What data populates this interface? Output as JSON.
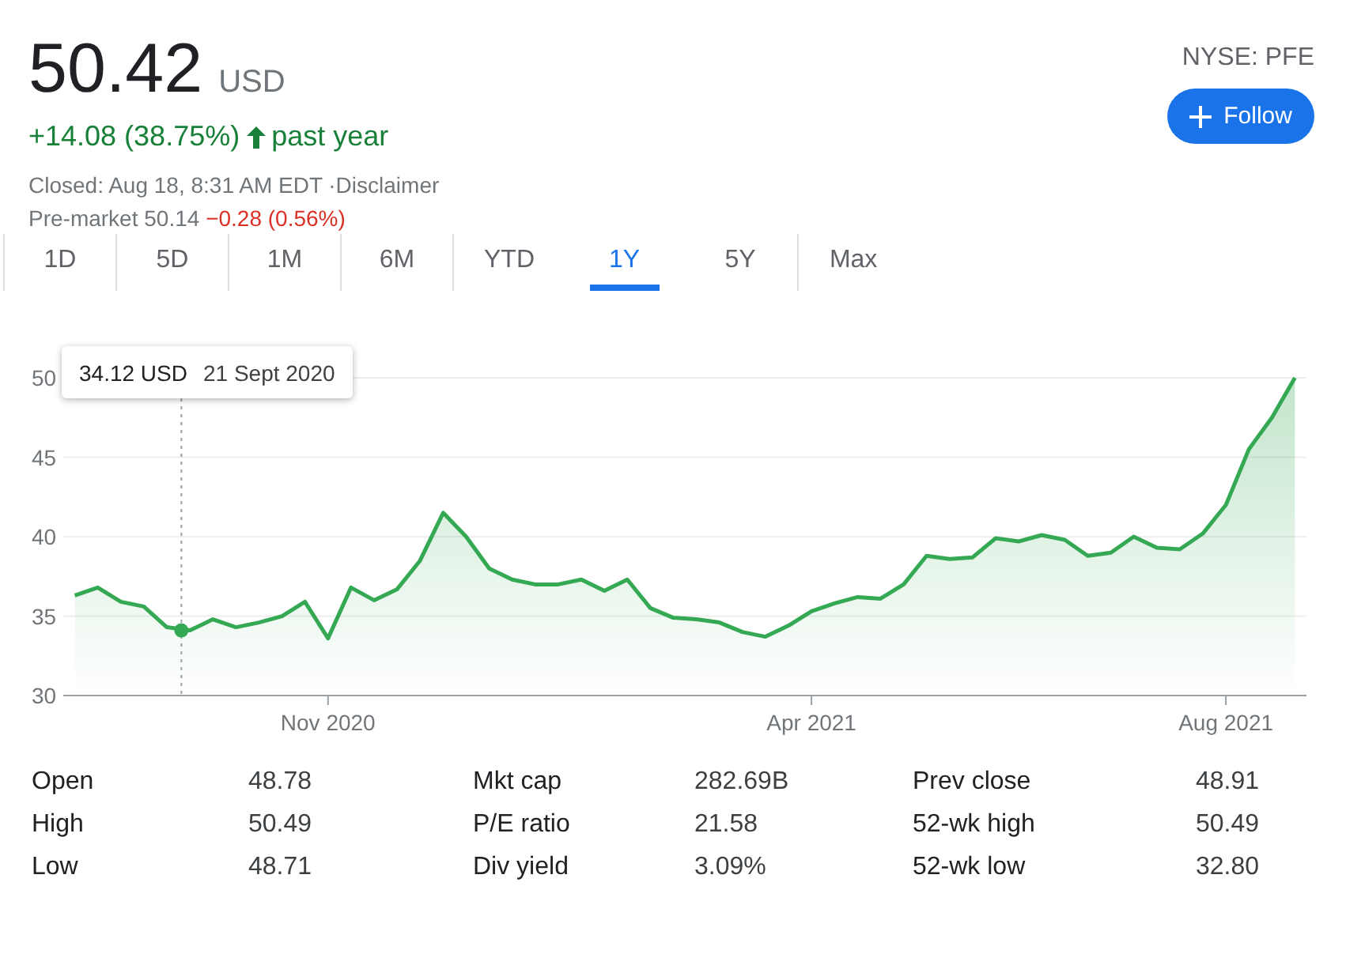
{
  "quote": {
    "price": "50.42",
    "currency": "USD",
    "change": "+14.08 (38.75%)",
    "up": true,
    "period": "past year",
    "status": "Closed: Aug 18, 8:31 AM EDT",
    "disclaimer": "·Disclaimer",
    "premarket_label": "Pre-market",
    "premarket_price": "50.14",
    "premarket_change": "−0.28 (0.56%)",
    "premarket_up": false
  },
  "ticker": "NYSE: PFE",
  "follow_button": {
    "label": "Follow"
  },
  "ranges": [
    {
      "label": "1D",
      "selected": false
    },
    {
      "label": "5D",
      "selected": false
    },
    {
      "label": "1M",
      "selected": false
    },
    {
      "label": "6M",
      "selected": false
    },
    {
      "label": "YTD",
      "selected": false
    },
    {
      "label": "1Y",
      "selected": true
    },
    {
      "label": "5Y",
      "selected": false
    },
    {
      "label": "Max",
      "selected": false
    }
  ],
  "chart": {
    "tooltip": {
      "price": "34.12 USD",
      "date": "21 Sept 2020",
      "level": 0.095
    },
    "chart_data": {
      "type": "area",
      "grid": true,
      "categories": [
        null,
        null,
        null,
        null,
        null,
        null,
        null,
        null,
        null,
        null,
        null,
        "Nov 2020",
        null,
        null,
        null,
        null,
        null,
        null,
        null,
        null,
        null,
        null,
        null,
        null,
        null,
        null,
        null,
        null,
        null,
        null,
        null,
        null,
        "Apr 2021",
        null,
        null,
        null,
        null,
        null,
        null,
        null,
        null,
        null,
        null,
        null,
        null,
        null,
        null,
        null,
        null,
        null,
        "Aug 2021",
        null,
        null,
        null
      ],
      "series": [
        {
          "color": "#34a853",
          "values": [
            36.3,
            36.8,
            35.9,
            35.6,
            34.3,
            34.1,
            34.8,
            34.3,
            34.6,
            35.0,
            35.9,
            33.6,
            36.8,
            36.0,
            36.7,
            38.5,
            41.5,
            40.0,
            38.0,
            37.3,
            37.0,
            37.0,
            37.3,
            36.6,
            37.3,
            35.5,
            34.9,
            34.8,
            34.6,
            34.0,
            33.7,
            34.4,
            35.3,
            35.8,
            36.2,
            36.1,
            37.0,
            38.8,
            38.6,
            38.7,
            39.9,
            39.7,
            40.1,
            39.8,
            38.8,
            39.0,
            40.0,
            39.3,
            39.2,
            40.2,
            42.0,
            45.5,
            47.5,
            50.0
          ]
        }
      ],
      "ylim": [
        30,
        50
      ],
      "yticks": [
        30,
        35,
        40,
        45,
        50
      ]
    }
  },
  "stats": [
    {
      "label": "Open",
      "value": "48.78"
    },
    {
      "label": "Mkt cap",
      "value": "282.69B"
    },
    {
      "label": "Prev close",
      "value": "48.91"
    },
    {
      "label": "High",
      "value": "50.49"
    },
    {
      "label": "P/E ratio",
      "value": "21.58"
    },
    {
      "label": "52-wk high",
      "value": "50.49"
    },
    {
      "label": "Low",
      "value": "48.71"
    },
    {
      "label": "Div yield",
      "value": "3.09%"
    },
    {
      "label": "52-wk low",
      "value": "32.80"
    }
  ]
}
